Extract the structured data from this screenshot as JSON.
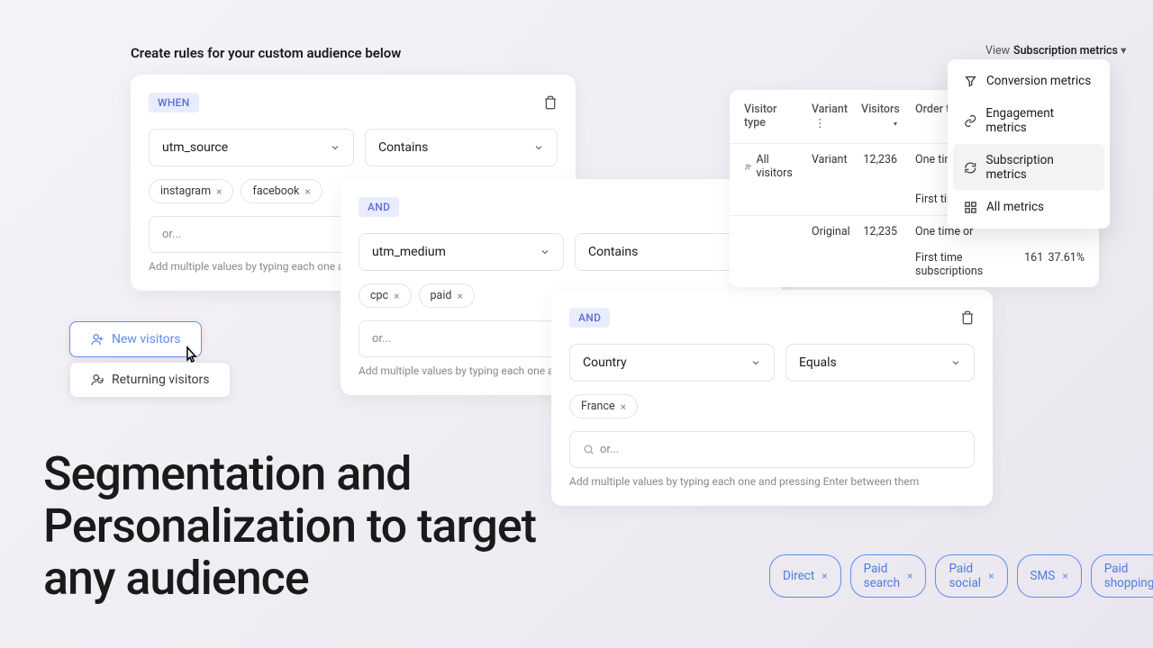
{
  "page_title": "Create rules for your custom audience below",
  "rule1": {
    "badge": "WHEN",
    "field": "utm_source",
    "operator": "Contains",
    "tags": [
      "instagram",
      "facebook"
    ],
    "placeholder": "or...",
    "helper": "Add multiple values by typing each one and press"
  },
  "rule2": {
    "badge": "AND",
    "field": "utm_medium",
    "operator": "Contains",
    "tags": [
      "cpc",
      "paid"
    ],
    "placeholder": "or...",
    "helper": "Add multiple values by typing each one and pressi"
  },
  "rule3": {
    "badge": "AND",
    "field": "Country",
    "operator": "Equals",
    "tags": [
      "France"
    ],
    "placeholder": "or...",
    "helper": "Add multiple values by typing each one and pressing Enter between them"
  },
  "visitor_new": "New visitors",
  "visitor_returning": "Returning visitors",
  "hero": "Segmentation and Personalization to target any audience",
  "view_label": "View",
  "view_value": "Subscription metrics",
  "metrics": {
    "conversion": "Conversion metrics",
    "engagement": "Engagement metrics",
    "subscription": "Subscription metrics",
    "all": "All metrics"
  },
  "table": {
    "headers": {
      "visitor": "Visitor type",
      "variant": "Variant",
      "visitors": "Visitors",
      "order": "Order type"
    },
    "row1": {
      "visitor": "All visitors",
      "variant": "Variant",
      "visitors": "12,236",
      "order1": "One time or",
      "order2": "First time su"
    },
    "row2": {
      "variant": "Original",
      "visitors": "12,235",
      "order1": "One time or",
      "sub_label": "First time subscriptions",
      "sub_count": "161",
      "sub_pct": "37.61%"
    }
  },
  "blue_tags": [
    "Direct",
    "Paid search",
    "Paid social",
    "SMS",
    "Paid shopping"
  ]
}
